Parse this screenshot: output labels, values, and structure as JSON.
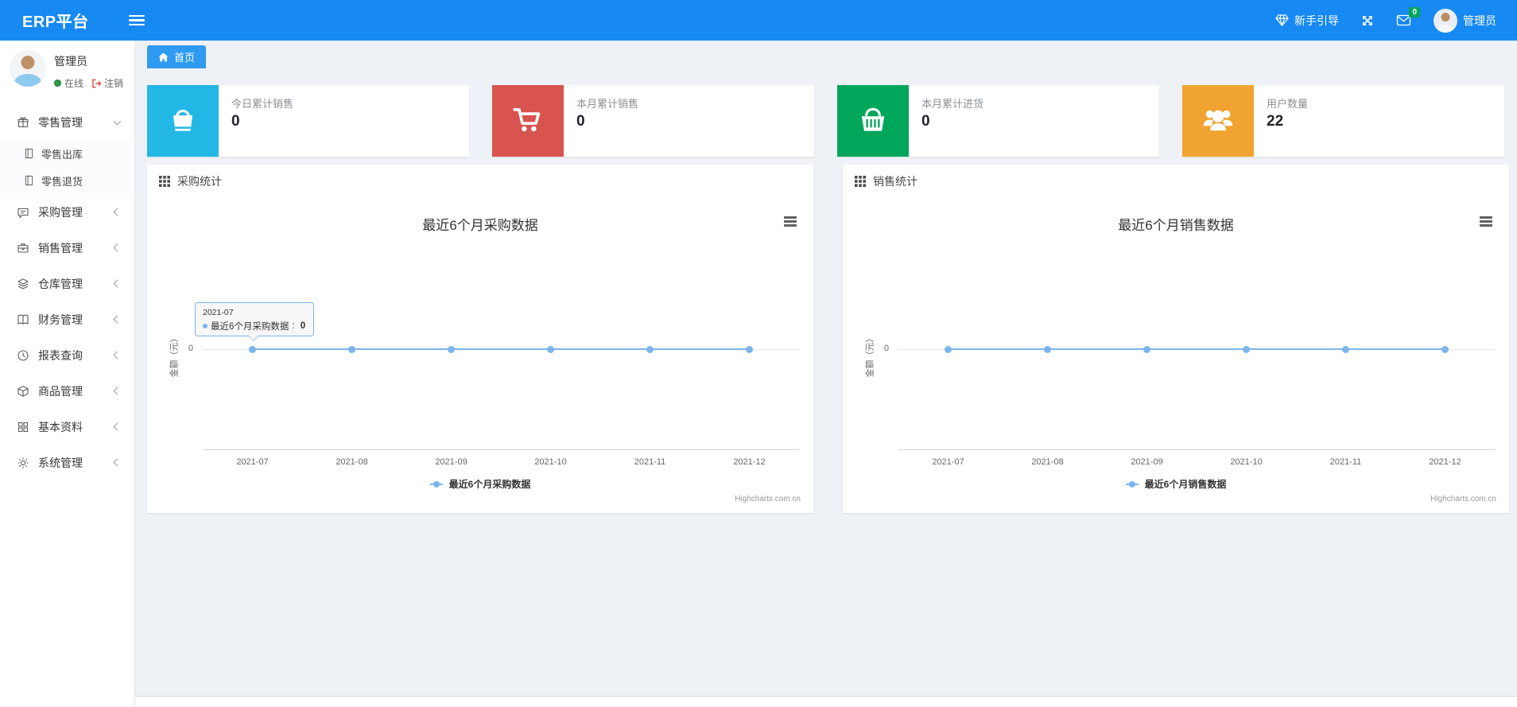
{
  "colors": {
    "navbar_blue": "#1789f2",
    "tab_blue": "#2e9af0",
    "page_bg": "#eef1f5",
    "badge_green": "#00a65a",
    "series_blue": "#7cb5ec"
  },
  "navbar": {
    "brand": "ERP平台",
    "guide_label": "新手引导",
    "mail_badge": "0",
    "username": "管理员"
  },
  "sidebar": {
    "user": {
      "name": "管理员",
      "status": "在线",
      "logout": "注销"
    },
    "menu": [
      {
        "label": "零售管理",
        "icon": "gift-icon",
        "chevron": "down",
        "children": [
          {
            "label": "零售出库",
            "icon": "notebook-icon"
          },
          {
            "label": "零售退货",
            "icon": "notebook-icon"
          }
        ]
      },
      {
        "label": "采购管理",
        "icon": "chat-icon",
        "chevron": "left"
      },
      {
        "label": "销售管理",
        "icon": "briefcase-icon",
        "chevron": "left"
      },
      {
        "label": "仓库管理",
        "icon": "layers-icon",
        "chevron": "left"
      },
      {
        "label": "财务管理",
        "icon": "book-icon",
        "chevron": "left"
      },
      {
        "label": "报表查询",
        "icon": "clock-icon",
        "chevron": "left"
      },
      {
        "label": "商品管理",
        "icon": "package-icon",
        "chevron": "left"
      },
      {
        "label": "基本资料",
        "icon": "grid-icon",
        "chevron": "left"
      },
      {
        "label": "系统管理",
        "icon": "gear-icon",
        "chevron": "left"
      }
    ]
  },
  "tabs": {
    "home": "首页"
  },
  "stat_cards": [
    {
      "label": "今日累计销售",
      "value": "0",
      "icon": "shopping-bag-icon",
      "color": "#23b7e5"
    },
    {
      "label": "本月累计销售",
      "value": "0",
      "icon": "cart-icon",
      "color": "#d9534f"
    },
    {
      "label": "本月累计进货",
      "value": "0",
      "icon": "basket-icon",
      "color": "#00a65a"
    },
    {
      "label": "用户数量",
      "value": "22",
      "icon": "users-icon",
      "color": "#f0a330"
    }
  ],
  "panels": [
    {
      "title": "采购统计",
      "icon": "th-grid-icon"
    },
    {
      "title": "销售统计",
      "icon": "th-grid-icon"
    }
  ],
  "chart_data": [
    {
      "type": "line",
      "title": "最近6个月采购数据",
      "x": [
        "2021-07",
        "2021-08",
        "2021-09",
        "2021-10",
        "2021-11",
        "2021-12"
      ],
      "series": [
        {
          "name": "最近6个月采购数据",
          "values": [
            0,
            0,
            0,
            0,
            0,
            0
          ]
        }
      ],
      "ylabel": "金额（元）",
      "yticks": [
        "0"
      ],
      "line_color": "#7cb5ec",
      "grid": true,
      "legend_position": "bottom",
      "credits": "Highcharts.com.cn",
      "tooltip": {
        "header": "2021-07",
        "label": "最近6个月采购数据",
        "value": "0",
        "separator": ": "
      }
    },
    {
      "type": "line",
      "title": "最近6个月销售数据",
      "x": [
        "2021-07",
        "2021-08",
        "2021-09",
        "2021-10",
        "2021-11",
        "2021-12"
      ],
      "series": [
        {
          "name": "最近6个月销售数据",
          "values": [
            0,
            0,
            0,
            0,
            0,
            0
          ]
        }
      ],
      "ylabel": "金额（元）",
      "yticks": [
        "0"
      ],
      "line_color": "#7cb5ec",
      "grid": true,
      "legend_position": "bottom",
      "credits": "Highcharts.com.cn"
    }
  ]
}
